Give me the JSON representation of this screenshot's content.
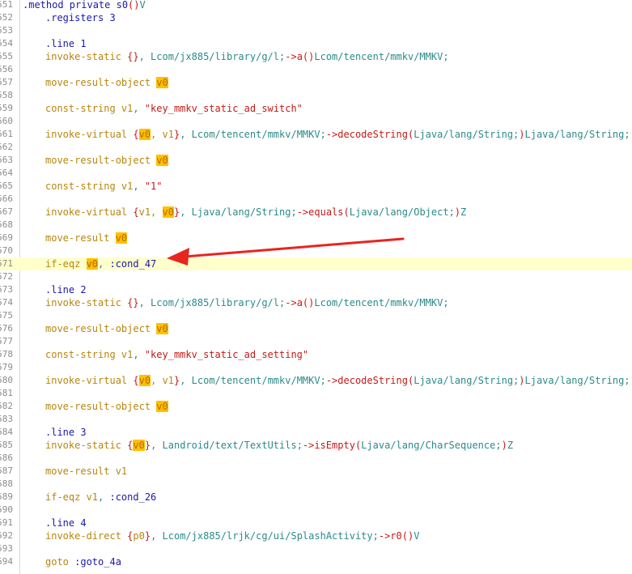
{
  "lines": [
    {
      "n": "551",
      "parts": [
        [
          "dir",
          ".method private s0"
        ],
        [
          "punc",
          "()"
        ],
        [
          "cls",
          "V"
        ]
      ],
      "indent": 0
    },
    {
      "n": "552",
      "parts": [
        [
          "dir",
          ".registers 3"
        ]
      ],
      "indent": 1
    },
    {
      "n": "553",
      "parts": [],
      "indent": 0
    },
    {
      "n": "554",
      "parts": [
        [
          "dir",
          ".line 1"
        ]
      ],
      "indent": 1
    },
    {
      "n": "555",
      "parts": [
        [
          "kw",
          "invoke-static "
        ],
        [
          "punc",
          "{}"
        ],
        [
          "cls",
          ", Lcom/jx885/library/g/l;"
        ],
        [
          "op",
          "->"
        ],
        [
          "meth",
          "a"
        ],
        [
          "punc",
          "()"
        ],
        [
          "cls",
          "Lcom/tencent/mmkv/MMKV;"
        ]
      ],
      "indent": 1
    },
    {
      "n": "556",
      "parts": [],
      "indent": 0
    },
    {
      "n": "557",
      "parts": [
        [
          "kw",
          "move-result-object "
        ],
        [
          "regv",
          "v0"
        ]
      ],
      "indent": 1
    },
    {
      "n": "558",
      "parts": [],
      "indent": 0
    },
    {
      "n": "559",
      "parts": [
        [
          "kw",
          "const-string "
        ],
        [
          "reg",
          "v1"
        ],
        [
          "cls",
          ", "
        ],
        [
          "str",
          "\"key_mmkv_static_ad_switch\""
        ]
      ],
      "indent": 1
    },
    {
      "n": "560",
      "parts": [],
      "indent": 0
    },
    {
      "n": "561",
      "parts": [
        [
          "kw",
          "invoke-virtual "
        ],
        [
          "punc",
          "{"
        ],
        [
          "regv",
          "v0"
        ],
        [
          "reg",
          ", v1"
        ],
        [
          "punc",
          "}"
        ],
        [
          "cls",
          ", Lcom/tencent/mmkv/MMKV;"
        ],
        [
          "op",
          "->"
        ],
        [
          "meth",
          "decodeString"
        ],
        [
          "punc",
          "("
        ],
        [
          "cls",
          "Ljava/lang/String;"
        ],
        [
          "punc",
          ")"
        ],
        [
          "cls",
          "Ljava/lang/String;"
        ]
      ],
      "indent": 1
    },
    {
      "n": "562",
      "parts": [],
      "indent": 0
    },
    {
      "n": "563",
      "parts": [
        [
          "kw",
          "move-result-object "
        ],
        [
          "regv",
          "v0"
        ]
      ],
      "indent": 1
    },
    {
      "n": "564",
      "parts": [],
      "indent": 0
    },
    {
      "n": "565",
      "parts": [
        [
          "kw",
          "const-string "
        ],
        [
          "reg",
          "v1"
        ],
        [
          "cls",
          ", "
        ],
        [
          "str",
          "\"1\""
        ]
      ],
      "indent": 1
    },
    {
      "n": "566",
      "parts": [],
      "indent": 0
    },
    {
      "n": "567",
      "parts": [
        [
          "kw",
          "invoke-virtual "
        ],
        [
          "punc",
          "{"
        ],
        [
          "reg",
          "v1, "
        ],
        [
          "regv",
          "v0"
        ],
        [
          "punc",
          "}"
        ],
        [
          "cls",
          ", Ljava/lang/String;"
        ],
        [
          "op",
          "->"
        ],
        [
          "meth",
          "equals"
        ],
        [
          "punc",
          "("
        ],
        [
          "cls",
          "Ljava/lang/Object;"
        ],
        [
          "punc",
          ")"
        ],
        [
          "cls",
          "Z"
        ]
      ],
      "indent": 1
    },
    {
      "n": "568",
      "parts": [],
      "indent": 0
    },
    {
      "n": "569",
      "parts": [
        [
          "kw",
          "move-result "
        ],
        [
          "regv",
          "v0"
        ]
      ],
      "indent": 1
    },
    {
      "n": "570",
      "parts": [],
      "indent": 0
    },
    {
      "n": "571",
      "parts": [
        [
          "kw",
          "if-eqz "
        ],
        [
          "regv",
          "v0"
        ],
        [
          "cls",
          ", "
        ],
        [
          "lbl",
          ":cond_47"
        ]
      ],
      "indent": 1,
      "highlight": true
    },
    {
      "n": "572",
      "parts": [],
      "indent": 0
    },
    {
      "n": "573",
      "parts": [
        [
          "dir",
          ".line 2"
        ]
      ],
      "indent": 1
    },
    {
      "n": "574",
      "parts": [
        [
          "kw",
          "invoke-static "
        ],
        [
          "punc",
          "{}"
        ],
        [
          "cls",
          ", Lcom/jx885/library/g/l;"
        ],
        [
          "op",
          "->"
        ],
        [
          "meth",
          "a"
        ],
        [
          "punc",
          "()"
        ],
        [
          "cls",
          "Lcom/tencent/mmkv/MMKV;"
        ]
      ],
      "indent": 1
    },
    {
      "n": "575",
      "parts": [],
      "indent": 0
    },
    {
      "n": "576",
      "parts": [
        [
          "kw",
          "move-result-object "
        ],
        [
          "regv",
          "v0"
        ]
      ],
      "indent": 1
    },
    {
      "n": "577",
      "parts": [],
      "indent": 0
    },
    {
      "n": "578",
      "parts": [
        [
          "kw",
          "const-string "
        ],
        [
          "reg",
          "v1"
        ],
        [
          "cls",
          ", "
        ],
        [
          "str",
          "\"key_mmkv_static_ad_setting\""
        ]
      ],
      "indent": 1
    },
    {
      "n": "579",
      "parts": [],
      "indent": 0
    },
    {
      "n": "580",
      "parts": [
        [
          "kw",
          "invoke-virtual "
        ],
        [
          "punc",
          "{"
        ],
        [
          "regv",
          "v0"
        ],
        [
          "reg",
          ", v1"
        ],
        [
          "punc",
          "}"
        ],
        [
          "cls",
          ", Lcom/tencent/mmkv/MMKV;"
        ],
        [
          "op",
          "->"
        ],
        [
          "meth",
          "decodeString"
        ],
        [
          "punc",
          "("
        ],
        [
          "cls",
          "Ljava/lang/String;"
        ],
        [
          "punc",
          ")"
        ],
        [
          "cls",
          "Ljava/lang/String;"
        ]
      ],
      "indent": 1
    },
    {
      "n": "581",
      "parts": [],
      "indent": 0
    },
    {
      "n": "582",
      "parts": [
        [
          "kw",
          "move-result-object "
        ],
        [
          "regv",
          "v0"
        ]
      ],
      "indent": 1
    },
    {
      "n": "583",
      "parts": [],
      "indent": 0
    },
    {
      "n": "584",
      "parts": [
        [
          "dir",
          ".line 3"
        ]
      ],
      "indent": 1
    },
    {
      "n": "585",
      "parts": [
        [
          "kw",
          "invoke-static "
        ],
        [
          "punc",
          "{"
        ],
        [
          "regv",
          "v0"
        ],
        [
          "punc",
          "}"
        ],
        [
          "cls",
          ", Landroid/text/TextUtils;"
        ],
        [
          "op",
          "->"
        ],
        [
          "meth",
          "isEmpty"
        ],
        [
          "punc",
          "("
        ],
        [
          "cls",
          "Ljava/lang/CharSequence;"
        ],
        [
          "punc",
          ")"
        ],
        [
          "cls",
          "Z"
        ]
      ],
      "indent": 1
    },
    {
      "n": "586",
      "parts": [],
      "indent": 0
    },
    {
      "n": "587",
      "parts": [
        [
          "kw",
          "move-result "
        ],
        [
          "reg",
          "v1"
        ]
      ],
      "indent": 1
    },
    {
      "n": "588",
      "parts": [],
      "indent": 0
    },
    {
      "n": "589",
      "parts": [
        [
          "kw",
          "if-eqz "
        ],
        [
          "reg",
          "v1"
        ],
        [
          "cls",
          ", "
        ],
        [
          "lbl",
          ":cond_26"
        ]
      ],
      "indent": 1
    },
    {
      "n": "590",
      "parts": [],
      "indent": 0
    },
    {
      "n": "591",
      "parts": [
        [
          "dir",
          ".line 4"
        ]
      ],
      "indent": 1
    },
    {
      "n": "592",
      "parts": [
        [
          "kw",
          "invoke-direct "
        ],
        [
          "punc",
          "{"
        ],
        [
          "reg",
          "p0"
        ],
        [
          "punc",
          "}"
        ],
        [
          "cls",
          ", Lcom/jx885/lrjk/cg/ui/SplashActivity;"
        ],
        [
          "op",
          "->"
        ],
        [
          "meth",
          "r0"
        ],
        [
          "punc",
          "()"
        ],
        [
          "cls",
          "V"
        ]
      ],
      "indent": 1
    },
    {
      "n": "593",
      "parts": [],
      "indent": 0
    },
    {
      "n": "594",
      "parts": [
        [
          "kw",
          "goto "
        ],
        [
          "lbl",
          ":goto_4a"
        ]
      ],
      "indent": 1
    }
  ],
  "annotation": {
    "color": "#e8251f"
  }
}
